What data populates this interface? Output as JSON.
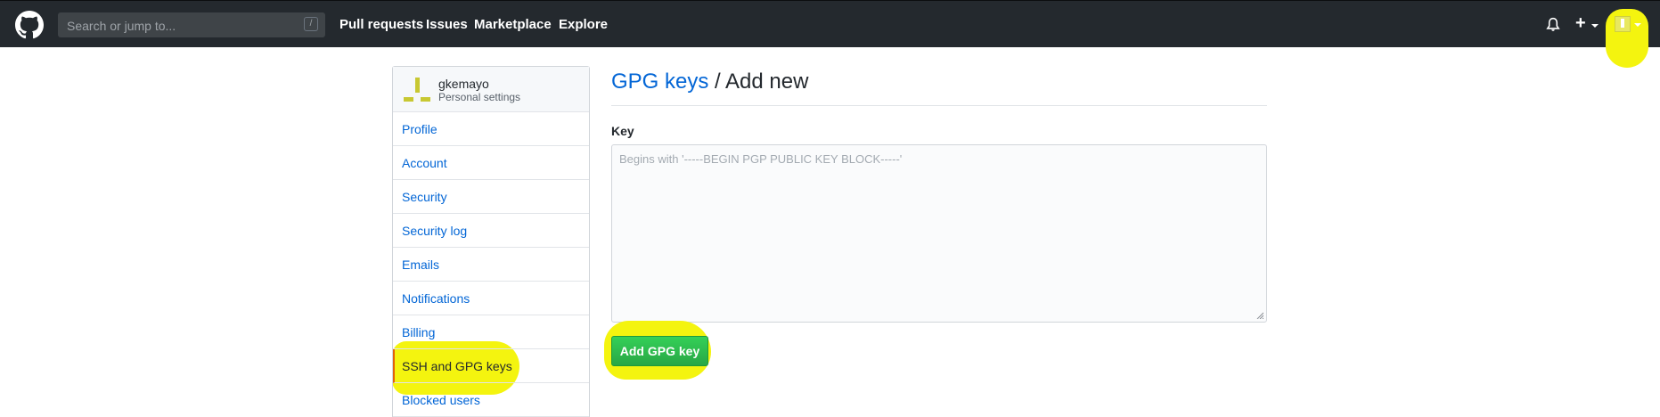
{
  "header": {
    "search_placeholder": "Search or jump to...",
    "search_shortcut": "/",
    "nav": [
      "Pull requests",
      "Issues",
      "Marketplace",
      "Explore"
    ],
    "plus_label": "+"
  },
  "sidebar": {
    "username": "gkemayo",
    "subtitle": "Personal settings",
    "items": [
      {
        "label": "Profile"
      },
      {
        "label": "Account"
      },
      {
        "label": "Security"
      },
      {
        "label": "Security log"
      },
      {
        "label": "Emails"
      },
      {
        "label": "Notifications"
      },
      {
        "label": "Billing"
      },
      {
        "label": "SSH and GPG keys",
        "selected": true
      },
      {
        "label": "Blocked users"
      }
    ]
  },
  "main": {
    "breadcrumb_link": "GPG keys",
    "breadcrumb_rest": " / Add new",
    "key_label": "Key",
    "key_placeholder": "Begins with '-----BEGIN PGP PUBLIC KEY BLOCK-----'",
    "key_value": "",
    "submit_label": "Add GPG key"
  },
  "colors": {
    "header_bg": "#24292e",
    "link": "#0366d6",
    "highlight": "#f4f40f",
    "button_green": "#28a745"
  }
}
